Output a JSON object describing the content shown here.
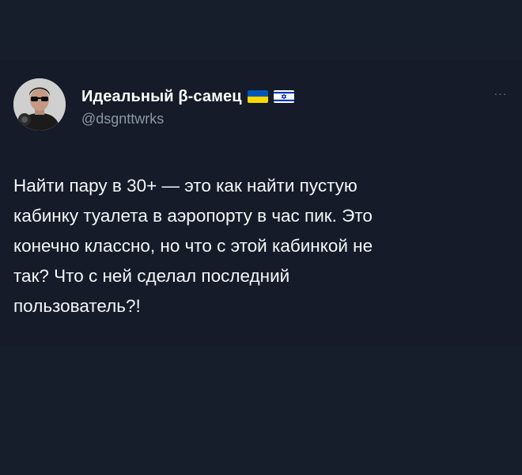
{
  "tweet": {
    "author": {
      "display_name": "Идеальный β-самец",
      "handle": "@dsgnttwrks",
      "avatar_icon": "user-avatar-photo",
      "flags": [
        "ukraine-flag-icon",
        "israel-flag-icon"
      ]
    },
    "more_icon": "more-options-icon",
    "more_label": "···",
    "text": "Найти пару в 30+ — это как найти пустую\nкабинку туалета в аэропорту в час пик. Это\nконечно классно, но что с этой кабинкой не\nтак? Что с ней сделал последний\nпользователь?!"
  },
  "colors": {
    "page_background": "#161d2b",
    "card_background": "#151b28",
    "text_primary": "#f5f7fa",
    "text_secondary": "#8b98a5",
    "ukraine_blue": "#0057b7",
    "ukraine_yellow": "#ffd700",
    "israel_blue": "#0038b8"
  }
}
